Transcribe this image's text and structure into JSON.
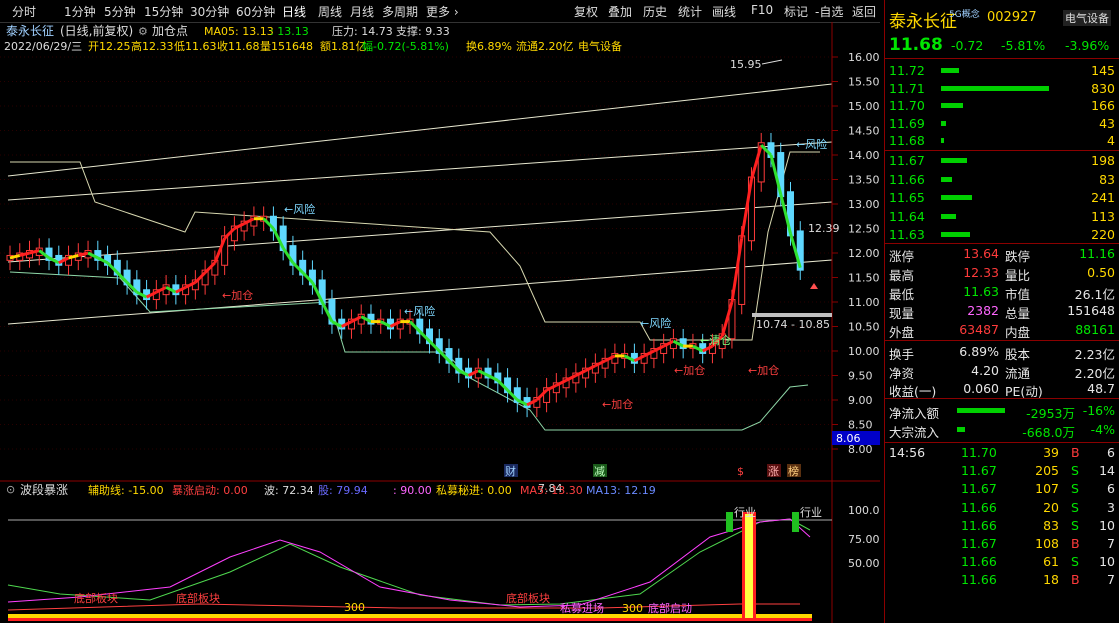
{
  "toolbar": {
    "periods": [
      "分时",
      "1分钟",
      "5分钟",
      "15分钟",
      "30分钟",
      "60分钟",
      "日线",
      "周线",
      "月线",
      "多周期",
      "更多"
    ],
    "active_period": "日线",
    "tools": [
      "复权",
      "叠加",
      "历史",
      "统计",
      "画线",
      "F10",
      "标记",
      "自选",
      "返回"
    ]
  },
  "main_chart": {
    "stock_name": "泰永长征",
    "mode": "(日线,前复权)",
    "indicator_name": "加仓点",
    "ma05_label": "MA05: 13.13",
    "ma05_value2": ": 13.13",
    "pressure": "压力: 14.73",
    "support": "支撑: 9.33",
    "info_line": {
      "date": "2022/06/29/三",
      "open": "开12.25",
      "high": "高12.33",
      "low": "低11.63",
      "close": "收11.68",
      "volume": "量151648",
      "amount": "额1.81亿",
      "change": "幅-0.72(-5.81%)",
      "turnover": "换6.89%",
      "float": "流通2.20亿",
      "sector": "电气设备"
    },
    "y_ticks": [
      "16.00",
      "15.50",
      "15.00",
      "14.50",
      "14.00",
      "13.50",
      "13.00",
      "12.50",
      "12.00",
      "11.50",
      "11.00",
      "10.50",
      "10.00",
      "9.50",
      "9.00",
      "8.50",
      "8.00"
    ],
    "current_price_tag": "8.06",
    "high_label": "15.95",
    "low_label": "7.84",
    "range_label": "10.74 - 10.85",
    "last_label": "12.39",
    "annotations": {
      "risk": "←风险",
      "risk_right": "←风险",
      "add": "←加仓",
      "clear": "←清仓"
    },
    "bottom_markers": [
      "财",
      "减",
      "$",
      "涨",
      "榜"
    ]
  },
  "sub_chart": {
    "name": "波段暴涨",
    "aux_line": "辅助线: -15.00",
    "surge_start": "暴涨启动: 0.00",
    "wave": "波: 72.34",
    "bull": "股: 79.94",
    "ninety": ": 90.00",
    "private_fund": "私募秘进: 0.00",
    "ma5": "MA5: 13.30",
    "ma13": "MA13: 12.19",
    "y_ticks": [
      "100.0",
      "75.00",
      "50.00"
    ],
    "labels": {
      "bottom_left1": "底部板块",
      "bottom_left2": "底部板块",
      "bottom_mid": "底部板块",
      "val_300": "300",
      "val_300b": "300",
      "mid_text": "私募进场",
      "mid_text2": "底部启动",
      "industry1": "行业",
      "industry2": "行业"
    }
  },
  "quote_panel": {
    "name": "泰永长征",
    "tag": "5G概念",
    "code": "002927",
    "sector": "电气设备",
    "price": "11.68",
    "change": "-0.72",
    "change_pct": "-5.81%",
    "sector_change": "-3.96%",
    "asks": [
      {
        "price": "11.72",
        "vol": "145",
        "bar": 0.17
      },
      {
        "price": "11.71",
        "vol": "830",
        "bar": 1.0
      },
      {
        "price": "11.70",
        "vol": "166",
        "bar": 0.2
      },
      {
        "price": "11.69",
        "vol": "43",
        "bar": 0.05
      },
      {
        "price": "11.68",
        "vol": "4",
        "bar": 0.02
      }
    ],
    "bids": [
      {
        "price": "11.67",
        "vol": "198",
        "bar": 0.24
      },
      {
        "price": "11.66",
        "vol": "83",
        "bar": 0.1
      },
      {
        "price": "11.65",
        "vol": "241",
        "bar": 0.29
      },
      {
        "price": "11.64",
        "vol": "113",
        "bar": 0.14
      },
      {
        "price": "11.63",
        "vol": "220",
        "bar": 0.27
      }
    ],
    "stats": [
      {
        "l1": "涨停",
        "v1": "13.64",
        "c1": "red",
        "l2": "跌停",
        "v2": "11.16",
        "c2": "green"
      },
      {
        "l1": "最高",
        "v1": "12.33",
        "c1": "red",
        "l2": "量比",
        "v2": "0.50",
        "c2": "yellow"
      },
      {
        "l1": "最低",
        "v1": "11.63",
        "c1": "green",
        "l2": "市值",
        "v2": "26.1亿",
        "c2": "white"
      },
      {
        "l1": "现量",
        "v1": "2382",
        "c1": "magenta",
        "l2": "总量",
        "v2": "151648",
        "c2": "white"
      },
      {
        "l1": "外盘",
        "v1": "63487",
        "c1": "red",
        "l2": "内盘",
        "v2": "88161",
        "c2": "green"
      }
    ],
    "stats2": [
      {
        "l1": "换手",
        "v1": "6.89%",
        "l2": "股本",
        "v2": "2.23亿"
      },
      {
        "l1": "净资",
        "v1": "4.20",
        "l2": "流通",
        "v2": "2.20亿"
      },
      {
        "l1": "收益(一)",
        "v1": "0.060",
        "l2": "PE(动)",
        "v2": "48.7"
      }
    ],
    "flows": [
      {
        "label": "净流入额",
        "value": "-2953万",
        "pct": "-16%",
        "bar": 0.6
      },
      {
        "label": "大宗流入",
        "value": "-668.0万",
        "pct": "-4%",
        "bar": 0.1
      }
    ],
    "ticks": [
      {
        "time": "14:56",
        "price": "11.70",
        "vol": "39",
        "side": "B",
        "n": "6"
      },
      {
        "time": "",
        "price": "11.67",
        "vol": "205",
        "side": "S",
        "n": "14"
      },
      {
        "time": "",
        "price": "11.67",
        "vol": "107",
        "side": "S",
        "n": "6"
      },
      {
        "time": "",
        "price": "11.66",
        "vol": "20",
        "side": "S",
        "n": "3"
      },
      {
        "time": "",
        "price": "11.66",
        "vol": "83",
        "side": "S",
        "n": "10"
      },
      {
        "time": "",
        "price": "11.67",
        "vol": "108",
        "side": "B",
        "n": "7"
      },
      {
        "time": "",
        "price": "11.66",
        "vol": "61",
        "side": "S",
        "n": "10"
      },
      {
        "time": "",
        "price": "11.66",
        "vol": "18",
        "side": "B",
        "n": "7"
      }
    ]
  }
}
